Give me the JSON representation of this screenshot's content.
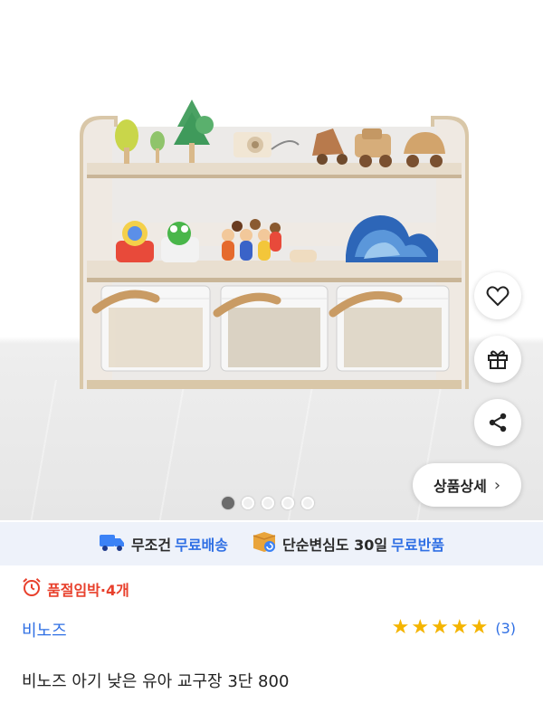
{
  "product_image": {
    "icon": "toy-shelf-product-photo",
    "carousel": {
      "total": 5,
      "active_index": 0
    }
  },
  "actions": {
    "like_icon": "heart-icon",
    "gift_icon": "gift-icon",
    "share_icon": "share-icon",
    "detail_label": "상품상세",
    "detail_chevron": "›"
  },
  "shipping": {
    "free_delivery_prefix": "무조건",
    "free_delivery_highlight": "무료배송",
    "return_prefix": "단순변심도 30일",
    "return_highlight": "무료반품",
    "accent_color": "#2f6fe4"
  },
  "stock": {
    "label": "품절임박·4개",
    "icon": "alarm-clock-icon",
    "color": "#e8402c"
  },
  "brand": {
    "name": "비노즈"
  },
  "rating": {
    "stars": 5,
    "max": 5,
    "review_count_label": "(3)"
  },
  "title": "비노즈 아기 낮은 유아 교구장 3단 800"
}
